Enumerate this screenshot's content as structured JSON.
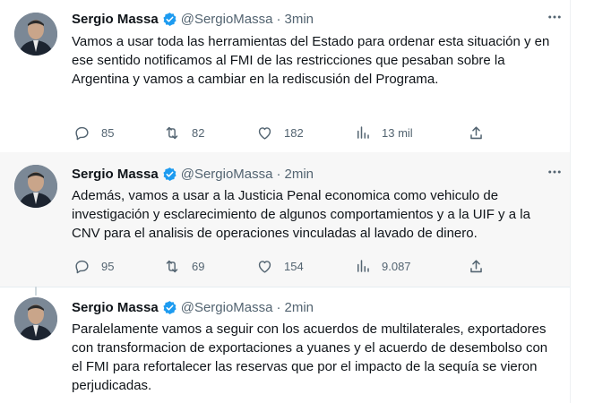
{
  "tweets": [
    {
      "name": "Sergio Massa",
      "handle": "@SergioMassa",
      "separator": "·",
      "time": "3min",
      "text": "Vamos a usar toda las herramientas del Estado para ordenar esta situación y en ese sentido notificamos al FMI de las restricciones que pesaban sobre la Argentina y vamos a cambiar en la rediscusión del Programa.",
      "replies": "85",
      "retweets": "82",
      "likes": "182",
      "views": "13 mil"
    },
    {
      "name": "Sergio Massa",
      "handle": "@SergioMassa",
      "separator": "·",
      "time": "2min",
      "text": "Además, vamos a usar a la Justicia Penal economica como vehiculo de investigación y esclarecimiento de algunos comportamientos y a la UIF y a la CNV para el analisis de operaciones vinculadas al lavado de dinero.",
      "replies": "95",
      "retweets": "69",
      "likes": "154",
      "views": "9.087"
    },
    {
      "name": "Sergio Massa",
      "handle": "@SergioMassa",
      "separator": "·",
      "time": "2min",
      "text": "Paralelamente vamos a seguir con los acuerdos de multilaterales, exportadores con transformacion de exportaciones a yuanes y el acuerdo de desembolso con el FMI para refortalecer las reservas que por el impacto de la sequía se vieron perjudicadas."
    }
  ],
  "colors": {
    "verified_badge": "#1d9bf0",
    "secondary_text": "#536471",
    "highlight_bg": "#f7f7f7"
  },
  "icons": [
    "reply-icon",
    "retweet-icon",
    "like-icon",
    "views-icon",
    "share-icon",
    "more-icon",
    "verified-icon"
  ]
}
